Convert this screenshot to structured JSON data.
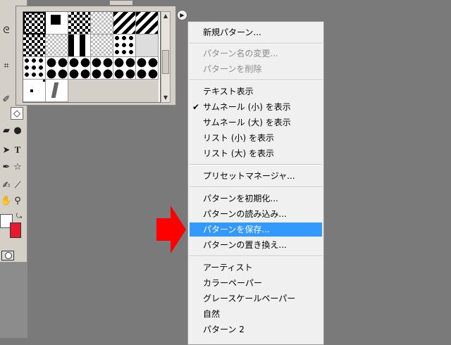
{
  "menu": {
    "new_pattern": "新規パターン...",
    "rename_pattern": "パターン名の変更...",
    "delete_pattern": "パターンを削除",
    "text_only": "テキスト表示",
    "small_thumbnail": "サムネール (小) を表示",
    "large_thumbnail": "サムネール (大) を表示",
    "small_list": "リスト (小) を表示",
    "large_list": "リスト (大) を表示",
    "preset_manager": "プリセットマネージャ...",
    "reset_patterns": "パターンを初期化...",
    "load_patterns": "パターンの読み込み...",
    "save_patterns": "パターンを保存...",
    "replace_patterns": "パターンの置き換え...",
    "artist": "アーティスト",
    "color_paper": "カラーペーパー",
    "grayscale_paper": "グレースケールペーパー",
    "nature": "自然",
    "patterns_2": "パターン 2",
    "check_mark": "✔"
  },
  "toolbar": {
    "type_tool": "T"
  },
  "colors": {
    "highlight": "#3399ff",
    "background_swatch": "#e8192c",
    "arrow": "#ff0000"
  }
}
